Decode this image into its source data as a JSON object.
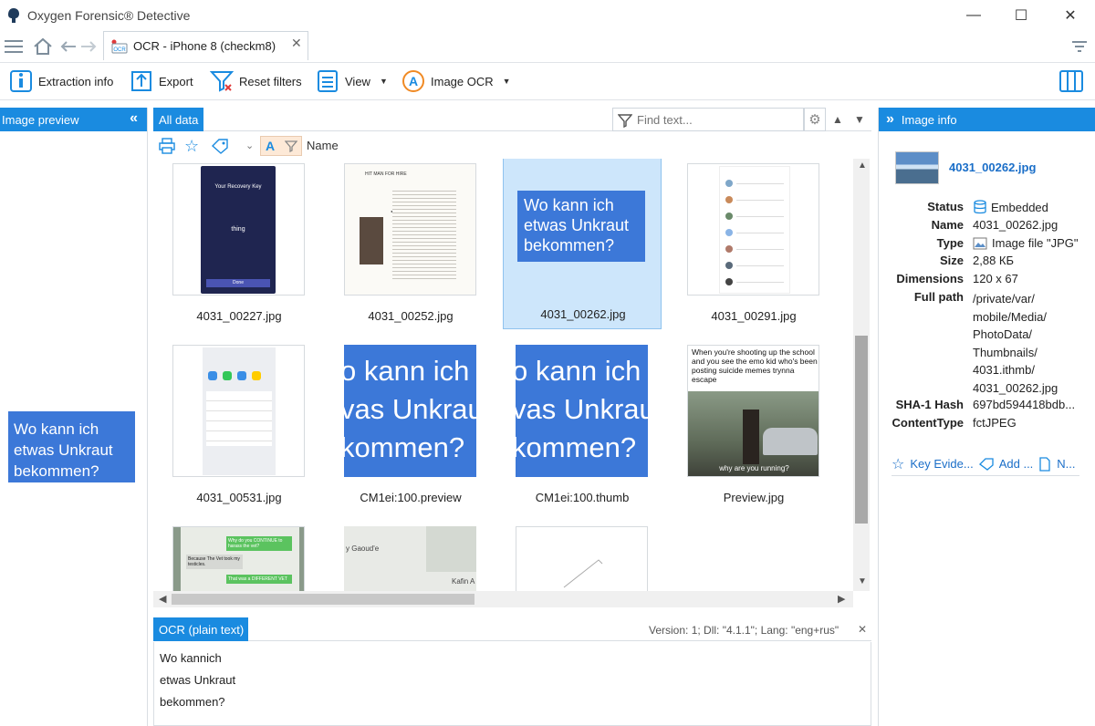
{
  "window": {
    "title": "Oxygen Forensic® Detective",
    "minimize_glyph": "—",
    "maximize_glyph": "☐",
    "close_glyph": "✕"
  },
  "tab": {
    "label": "OCR - iPhone 8 (checkm8)",
    "icon_text": "OCR",
    "close_glyph": "✕"
  },
  "toolbar": {
    "extraction_info": "Extraction info",
    "export": "Export",
    "reset_filters": "Reset filters",
    "view": "View",
    "image_ocr": "Image OCR"
  },
  "left_panel": {
    "title": "Image preview",
    "collapse_glyph": "«",
    "preview_text": [
      "Wo kann ich",
      "etwas Unkraut",
      "bekommen?"
    ]
  },
  "center": {
    "tab_label": "All data",
    "find_placeholder": "Find text...",
    "sort_label": "Name",
    "items": [
      {
        "name": "4031_00227.jpg",
        "kind": "phone-dark",
        "phone_title": "Your Recovery Key",
        "phone_word": "thing",
        "phone_button": "Done"
      },
      {
        "name": "4031_00252.jpg",
        "kind": "document",
        "doc_title": "HIT MAN FOR HIRE"
      },
      {
        "name": "4031_00262.jpg",
        "kind": "text-blue",
        "selected": true,
        "lines": [
          "Wo kann ich",
          "etwas Unkraut",
          "bekommen?"
        ]
      },
      {
        "name": "4031_00291.jpg",
        "kind": "chat-list"
      },
      {
        "name": "4031_00531.jpg",
        "kind": "share-sheet"
      },
      {
        "name": "CM1ei:100.preview",
        "kind": "text-big",
        "lines": [
          "o kann ich",
          "vas Unkraut",
          "kommen?"
        ]
      },
      {
        "name": "CM1ei:100.thumb",
        "kind": "text-big",
        "lines": [
          "o kann ich",
          "vas Unkraut",
          "kommen?"
        ]
      },
      {
        "name": "Preview.jpg",
        "kind": "meme",
        "caption": "When you're shooting up the school and you see the emo kid who's been posting suicide memes trynna escape",
        "subtitle": "why are you running?"
      },
      {
        "name": "",
        "kind": "green-chat",
        "bubbles": [
          "Why do you CONTINUE to harass the vet?",
          "Because The Vet took my testicles.",
          "That was a DIFFERENT VET"
        ]
      },
      {
        "name": "",
        "kind": "map",
        "labels": [
          "y Gaoud'e",
          "Kafin A"
        ]
      },
      {
        "name": "",
        "kind": "sketch"
      }
    ]
  },
  "right_panel": {
    "title": "Image info",
    "expand_glyph": "»",
    "file_name": "4031_00262.jpg",
    "fields": [
      {
        "label": "Status",
        "value": "Embedded",
        "icon": "database-icon"
      },
      {
        "label": "Name",
        "value": "4031_00262.jpg"
      },
      {
        "label": "Type",
        "value": "Image file \"JPG\"",
        "icon": "image-file-icon"
      },
      {
        "label": "Size",
        "value": "2,88 КБ"
      },
      {
        "label": "Dimensions",
        "value": "120 x 67"
      },
      {
        "label": "Full path",
        "value_lines": [
          "/private/var/",
          "mobile/Media/",
          "PhotoData/",
          "Thumbnails/",
          "4031.ithmb/",
          "4031_00262.jpg"
        ]
      },
      {
        "label": "SHA-1 Hash",
        "value": "697bd594418bdb..."
      },
      {
        "label": "ContentType",
        "value": "fctJPEG"
      }
    ],
    "actions": {
      "key_evidence": "Key Evide...",
      "add_tag": "Add ...",
      "note": "N..."
    }
  },
  "ocr_panel": {
    "title": "OCR (plain text)",
    "version_info": "Version: 1; Dll: \"4.1.1\"; Lang: \"eng+rus\"",
    "close_glyph": "✕",
    "lines": [
      "Wo kannich",
      "etwas Unkraut",
      "bekommen?"
    ]
  },
  "colors": {
    "accent": "#1a8be0",
    "selection": "#cde6fb",
    "tile_blue": "#3c78d8"
  }
}
